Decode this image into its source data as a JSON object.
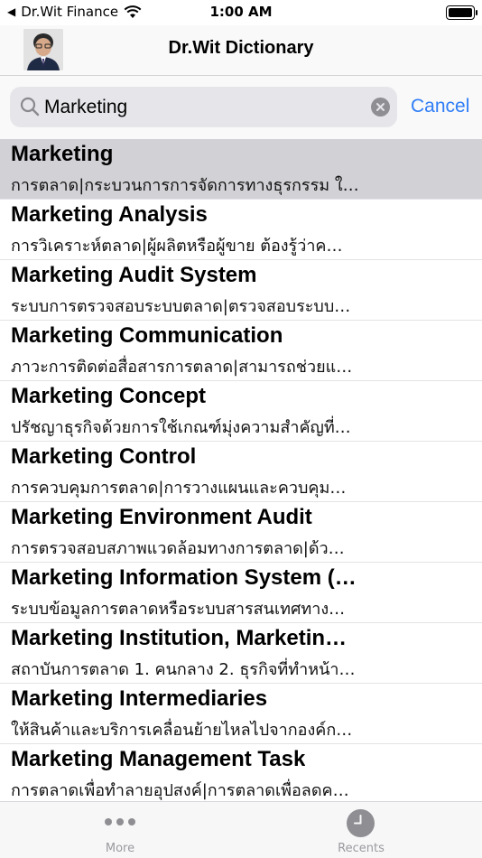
{
  "status": {
    "carrier": "Dr.Wit Finance",
    "time": "1:00 AM"
  },
  "nav": {
    "title": "Dr.Wit Dictionary"
  },
  "search": {
    "value": "Marketing",
    "cancel_label": "Cancel"
  },
  "results": [
    {
      "title": "Marketing",
      "subtitle": "การตลาด|กระบวนการการจัดการทางธุรกรรม ใ…"
    },
    {
      "title": "Marketing Analysis",
      "subtitle": "การวิเคราะห์ตลาด|ผู้ผลิตหรือผู้ขาย ต้องรู้ว่าค…"
    },
    {
      "title": "Marketing Audit System",
      "subtitle": "ระบบการตรวจสอบระบบตลาด|ตรวจสอบระบบ…"
    },
    {
      "title": "Marketing Communication",
      "subtitle": "ภาวะการติดต่อสื่อสารการตลาด|สามารถช่วยแ…"
    },
    {
      "title": "Marketing Concept",
      "subtitle": "ปรัชญาธุรกิจด้วยการใช้เกณฑ์มุ่งความสำคัญที่…"
    },
    {
      "title": "Marketing Control",
      "subtitle": "การควบคุมการตลาด|การวางแผนและควบคุม…"
    },
    {
      "title": "Marketing Environment Audit",
      "subtitle": "การตรวจสอบสภาพแวดล้อมทางการตลาด|ด้ว…"
    },
    {
      "title": "Marketing Information System (…",
      "subtitle": "ระบบข้อมูลการตลาดหรือระบบสารสนเทศทาง…"
    },
    {
      "title": "Marketing Institution, Marketin…",
      "subtitle": "สถาบันการตลาด 1. คนกลาง 2. ธุรกิจที่ทำหน้า…"
    },
    {
      "title": "Marketing Intermediaries",
      "subtitle": "ให้สินค้าและบริการเคลื่อนย้ายไหลไปจากองค์ก…"
    },
    {
      "title": "Marketing Management Task",
      "subtitle": "การตลาดเพื่อทำลายอุปสงค์|การตลาดเพื่อลดค…"
    }
  ],
  "selected_index": 0,
  "tabs": [
    {
      "label": "More",
      "icon": "more-dots-icon"
    },
    {
      "label": "Recents",
      "icon": "clock-icon"
    }
  ],
  "colors": {
    "accent": "#2f7df6",
    "selected_row": "#d1d1d6",
    "tab_inactive": "#9a9aa0"
  }
}
